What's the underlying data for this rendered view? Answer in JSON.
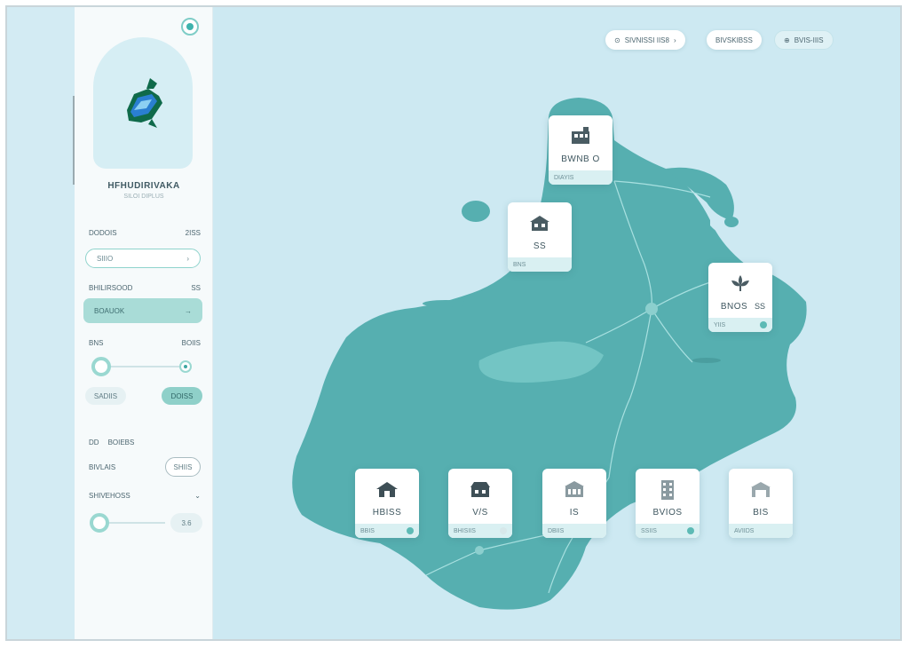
{
  "sidebar": {
    "title": "HFHUDIRIVAKA",
    "subtitle": "SILOI DIPLUS",
    "row1": {
      "label": "DODOIS",
      "value": "2ISS"
    },
    "search": {
      "value": "SIIIO",
      "icon": "chevron-right-icon"
    },
    "row2": {
      "label": "BHILIRSOOD",
      "value": "SS"
    },
    "active_item": {
      "label": "BOAUOK",
      "icon": "arrow-right-icon"
    },
    "row3": {
      "label": "BNS",
      "value": "BOIIS"
    },
    "chip_left": "SADIIS",
    "chip_right": "DOISS",
    "section": {
      "icon_text": "DD",
      "label": "BOIEBS"
    },
    "row4": {
      "label": "BIVLAIS",
      "button": "SHIIS"
    },
    "row5": {
      "label": "SHIVEHOSS",
      "icon": "chevron-down-icon"
    },
    "slider2_value": "3.6",
    "slider1_level": 0.05,
    "slider2_level": 0.05
  },
  "toolbar": {
    "chip1": {
      "icon": "target-icon",
      "text": "SIVNISSI IIS8",
      "icon2": "chevron-right-icon"
    },
    "chip2": {
      "text": "BIVSKIBSS"
    },
    "chip3": {
      "icon": "layers-icon",
      "text": "BVIS-IIIS"
    }
  },
  "cards": [
    {
      "icon": "building-icon",
      "label": "BWNB O",
      "foot": "DIAYIS"
    },
    {
      "icon": "house-icon",
      "label": "SS",
      "foot": "BNS"
    },
    {
      "icon": "plant-icon",
      "label": "BNOS",
      "foot": "YIIS",
      "side": "SS"
    },
    {
      "icon": "house-icon",
      "label": "HBISS",
      "foot": "BBIS"
    },
    {
      "icon": "store-icon",
      "label": "V/S",
      "foot": "BHISIIS"
    },
    {
      "icon": "bank-icon",
      "label": "IS",
      "foot": "DBIIS"
    },
    {
      "icon": "tower-icon",
      "label": "BVIOS",
      "foot": "SSIIS"
    },
    {
      "icon": "garage-icon",
      "label": "BIS",
      "foot": "AVIIDS"
    }
  ],
  "colors": {
    "accent": "#3fb3ad",
    "land": "#56afb0",
    "water": "#cde9f2",
    "lake": "#73c5c4"
  }
}
